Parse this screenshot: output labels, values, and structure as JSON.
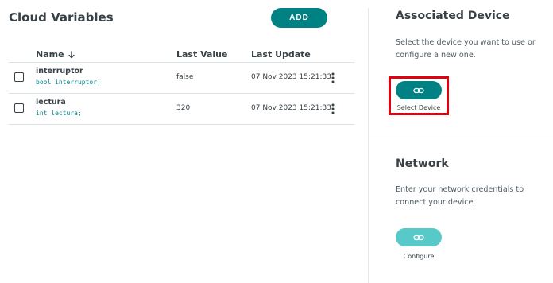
{
  "variables_panel": {
    "title": "Cloud Variables",
    "add_label": "ADD",
    "columns": {
      "name": "Name",
      "last_value": "Last Value",
      "last_update": "Last Update"
    },
    "sort_icon": "arrow-down-icon",
    "rows": [
      {
        "name": "interruptor",
        "declaration": "bool interruptor;",
        "last_value": "false",
        "last_update": "07 Nov 2023 15:21:33"
      },
      {
        "name": "lectura",
        "declaration": "int lectura;",
        "last_value": "320",
        "last_update": "07 Nov 2023 15:21:33"
      }
    ],
    "row_menu_icon": "more-vertical-icon"
  },
  "device_panel": {
    "title": "Associated Device",
    "description": "Select the device you want to use or configure a new one.",
    "button_icon": "link-icon",
    "button_label": "Select Device",
    "highlight_color": "#e3000f"
  },
  "network_panel": {
    "title": "Network",
    "description": "Enter your network credentials to connect your device.",
    "button_icon": "link-icon",
    "button_label": "Configure"
  },
  "colors": {
    "accent": "#008184",
    "accent_light": "#58c9c9",
    "text": "#374146",
    "divider": "#dae3e3"
  }
}
